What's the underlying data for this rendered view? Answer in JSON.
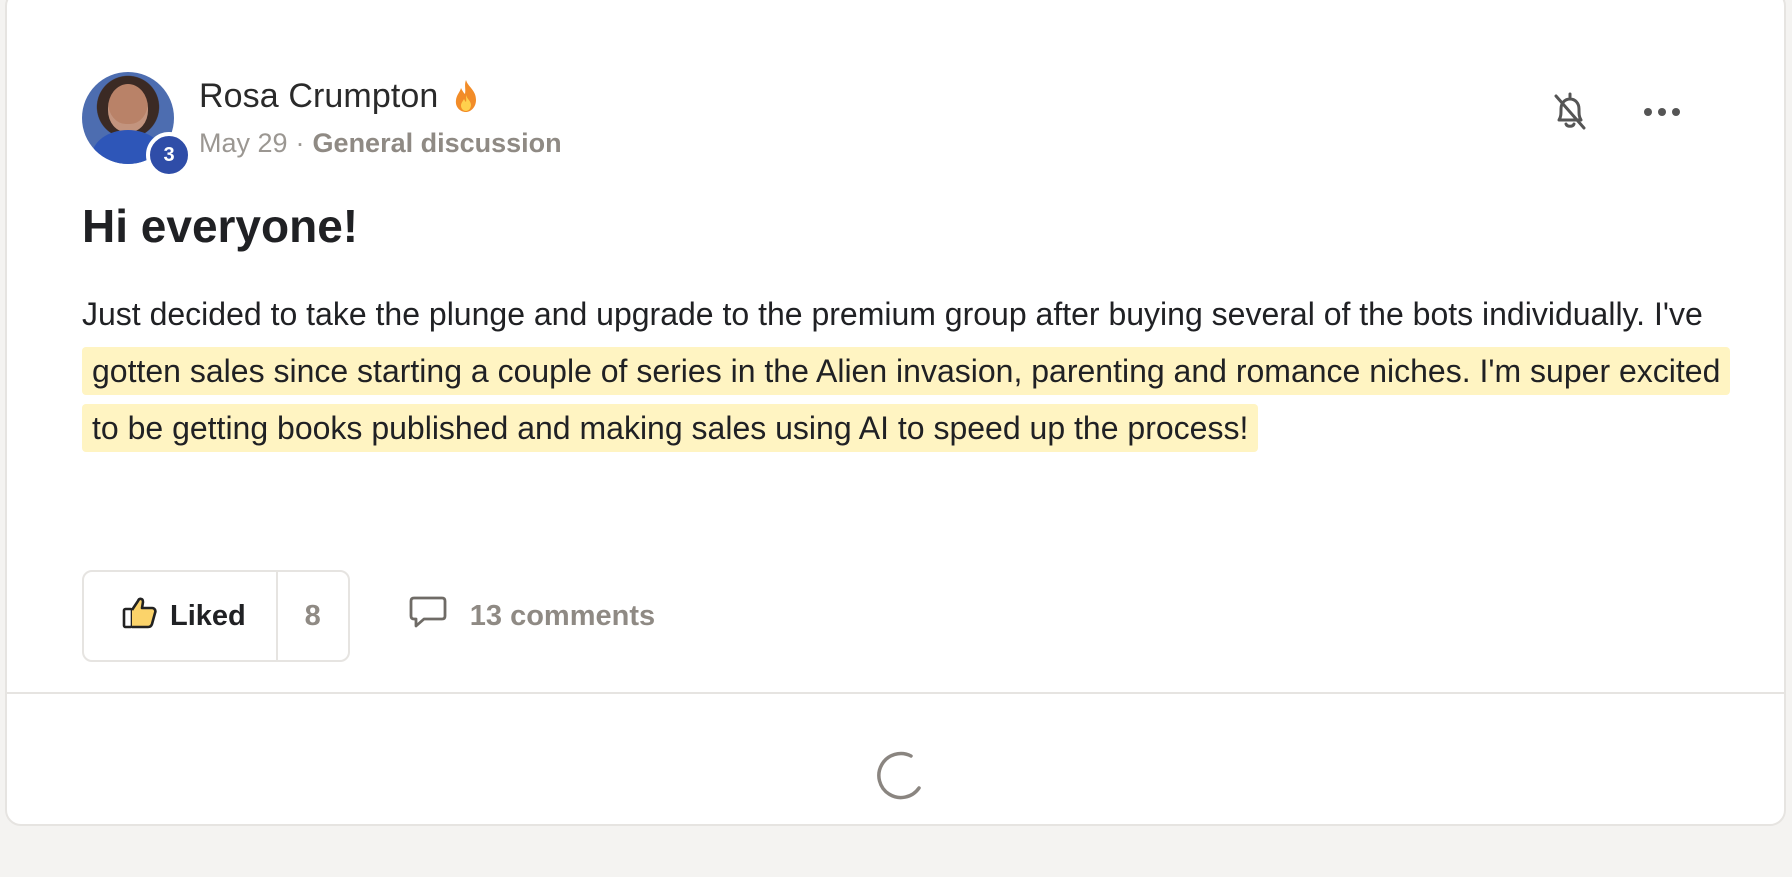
{
  "post": {
    "author": {
      "name": "Rosa Crumpton",
      "level": "3",
      "streak_icon": "flame-icon"
    },
    "date": "May 29",
    "separator": "·",
    "category": "General discussion",
    "title": "Hi everyone!",
    "body_plain": "Just decided to take the plunge and upgrade to the premium group after buying several of the bots individually. I've",
    "body_highlighted": "gotten sales since starting a couple of series in the Alien invasion, parenting and romance niches. I'm super excited to be getting books published and making sales using AI to speed up the process!",
    "actions": {
      "like_label": "Liked",
      "like_count": "8",
      "comments_label": "13 comments"
    }
  },
  "header_icons": {
    "notifications": "bell-off-icon",
    "more": "more-options-icon"
  },
  "colors": {
    "highlight": "#fff4c2",
    "badge": "#2f4da8",
    "muted_text": "#8f8a84"
  },
  "loading": {
    "spinner": "loading-spinner-icon"
  }
}
